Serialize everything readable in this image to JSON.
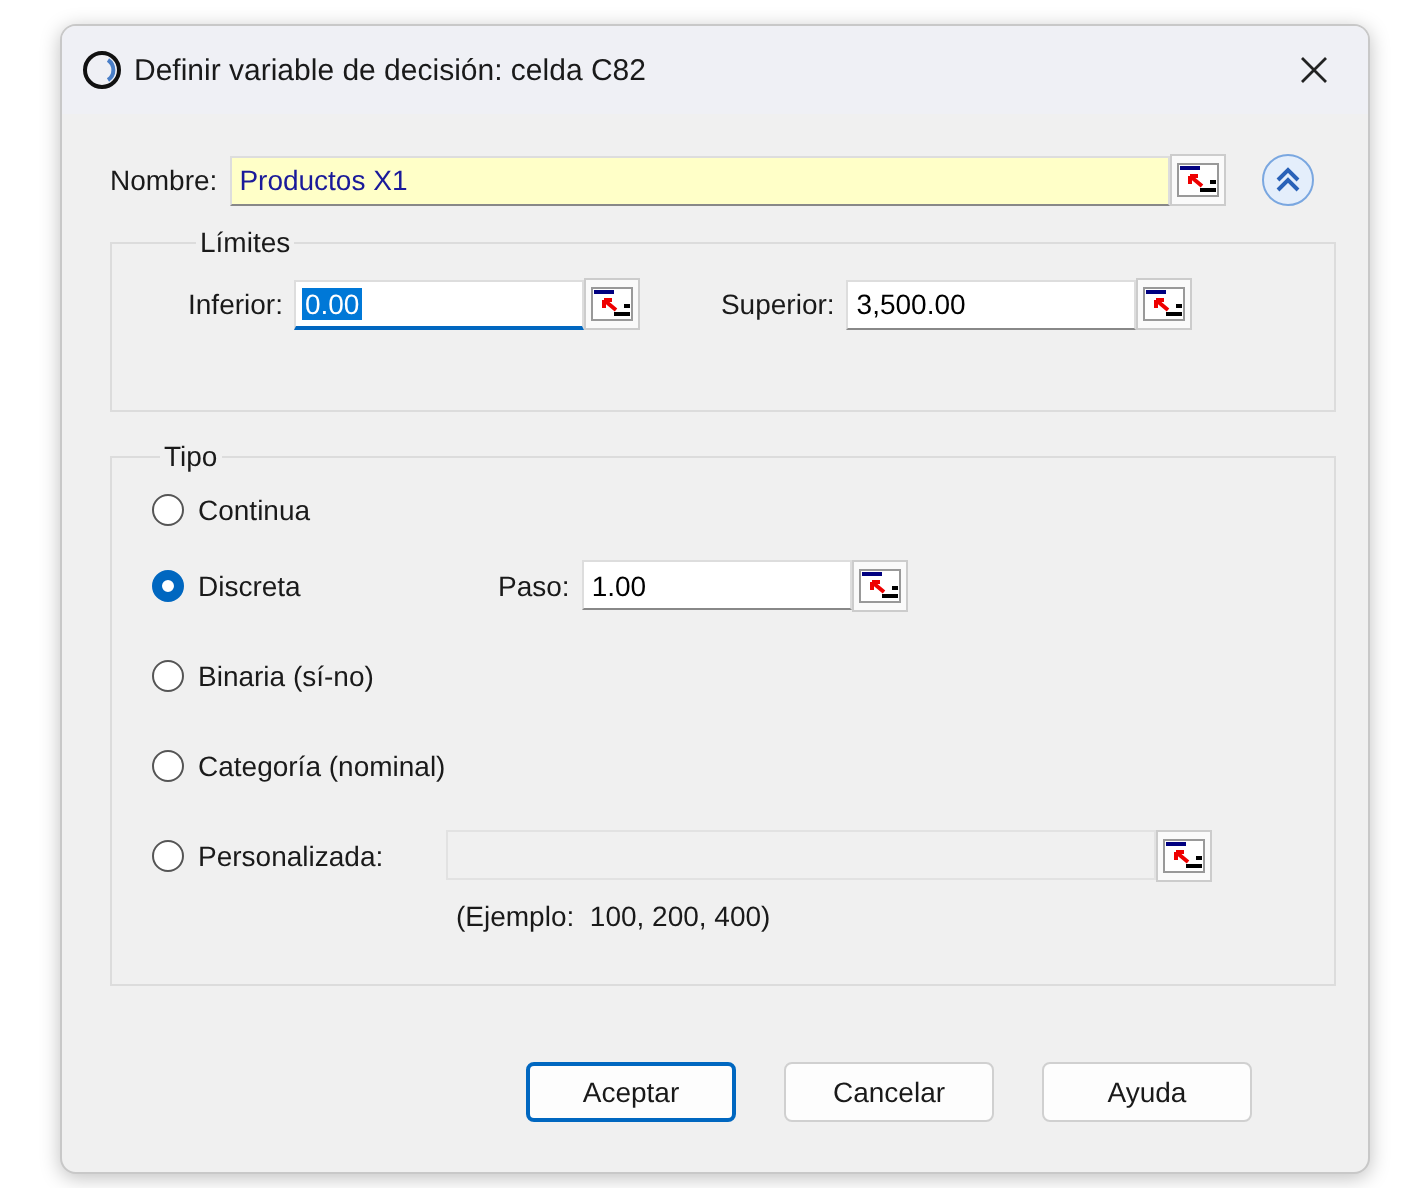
{
  "window": {
    "title": "Definir variable de decisión: celda C82"
  },
  "name_field": {
    "label": "Nombre:",
    "value": "Productos X1"
  },
  "limits": {
    "title": "Límites",
    "fields": [
      {
        "label": "Inferior:",
        "value": "0.00",
        "focused": true
      },
      {
        "label": "Superior:",
        "value": "3,500.00",
        "focused": false
      }
    ]
  },
  "type": {
    "title": "Tipo",
    "options": [
      {
        "label": "Continua",
        "selected": false
      },
      {
        "label": "Discreta",
        "selected": true,
        "field": {
          "label": "Paso:",
          "value": "1.00",
          "disabled": false
        }
      },
      {
        "label": "Binaria (sí-no)",
        "selected": false
      },
      {
        "label": "Categoría (nominal)",
        "selected": false
      },
      {
        "label": "Personalizada:",
        "selected": false,
        "field": {
          "disabled": true
        },
        "hint": "(Ejemplo:  100, 200, 400)"
      }
    ]
  },
  "buttons": [
    {
      "label": "Aceptar",
      "default": true
    },
    {
      "label": "Cancelar",
      "default": false
    },
    {
      "label": "Ayuda",
      "default": false
    }
  ]
}
